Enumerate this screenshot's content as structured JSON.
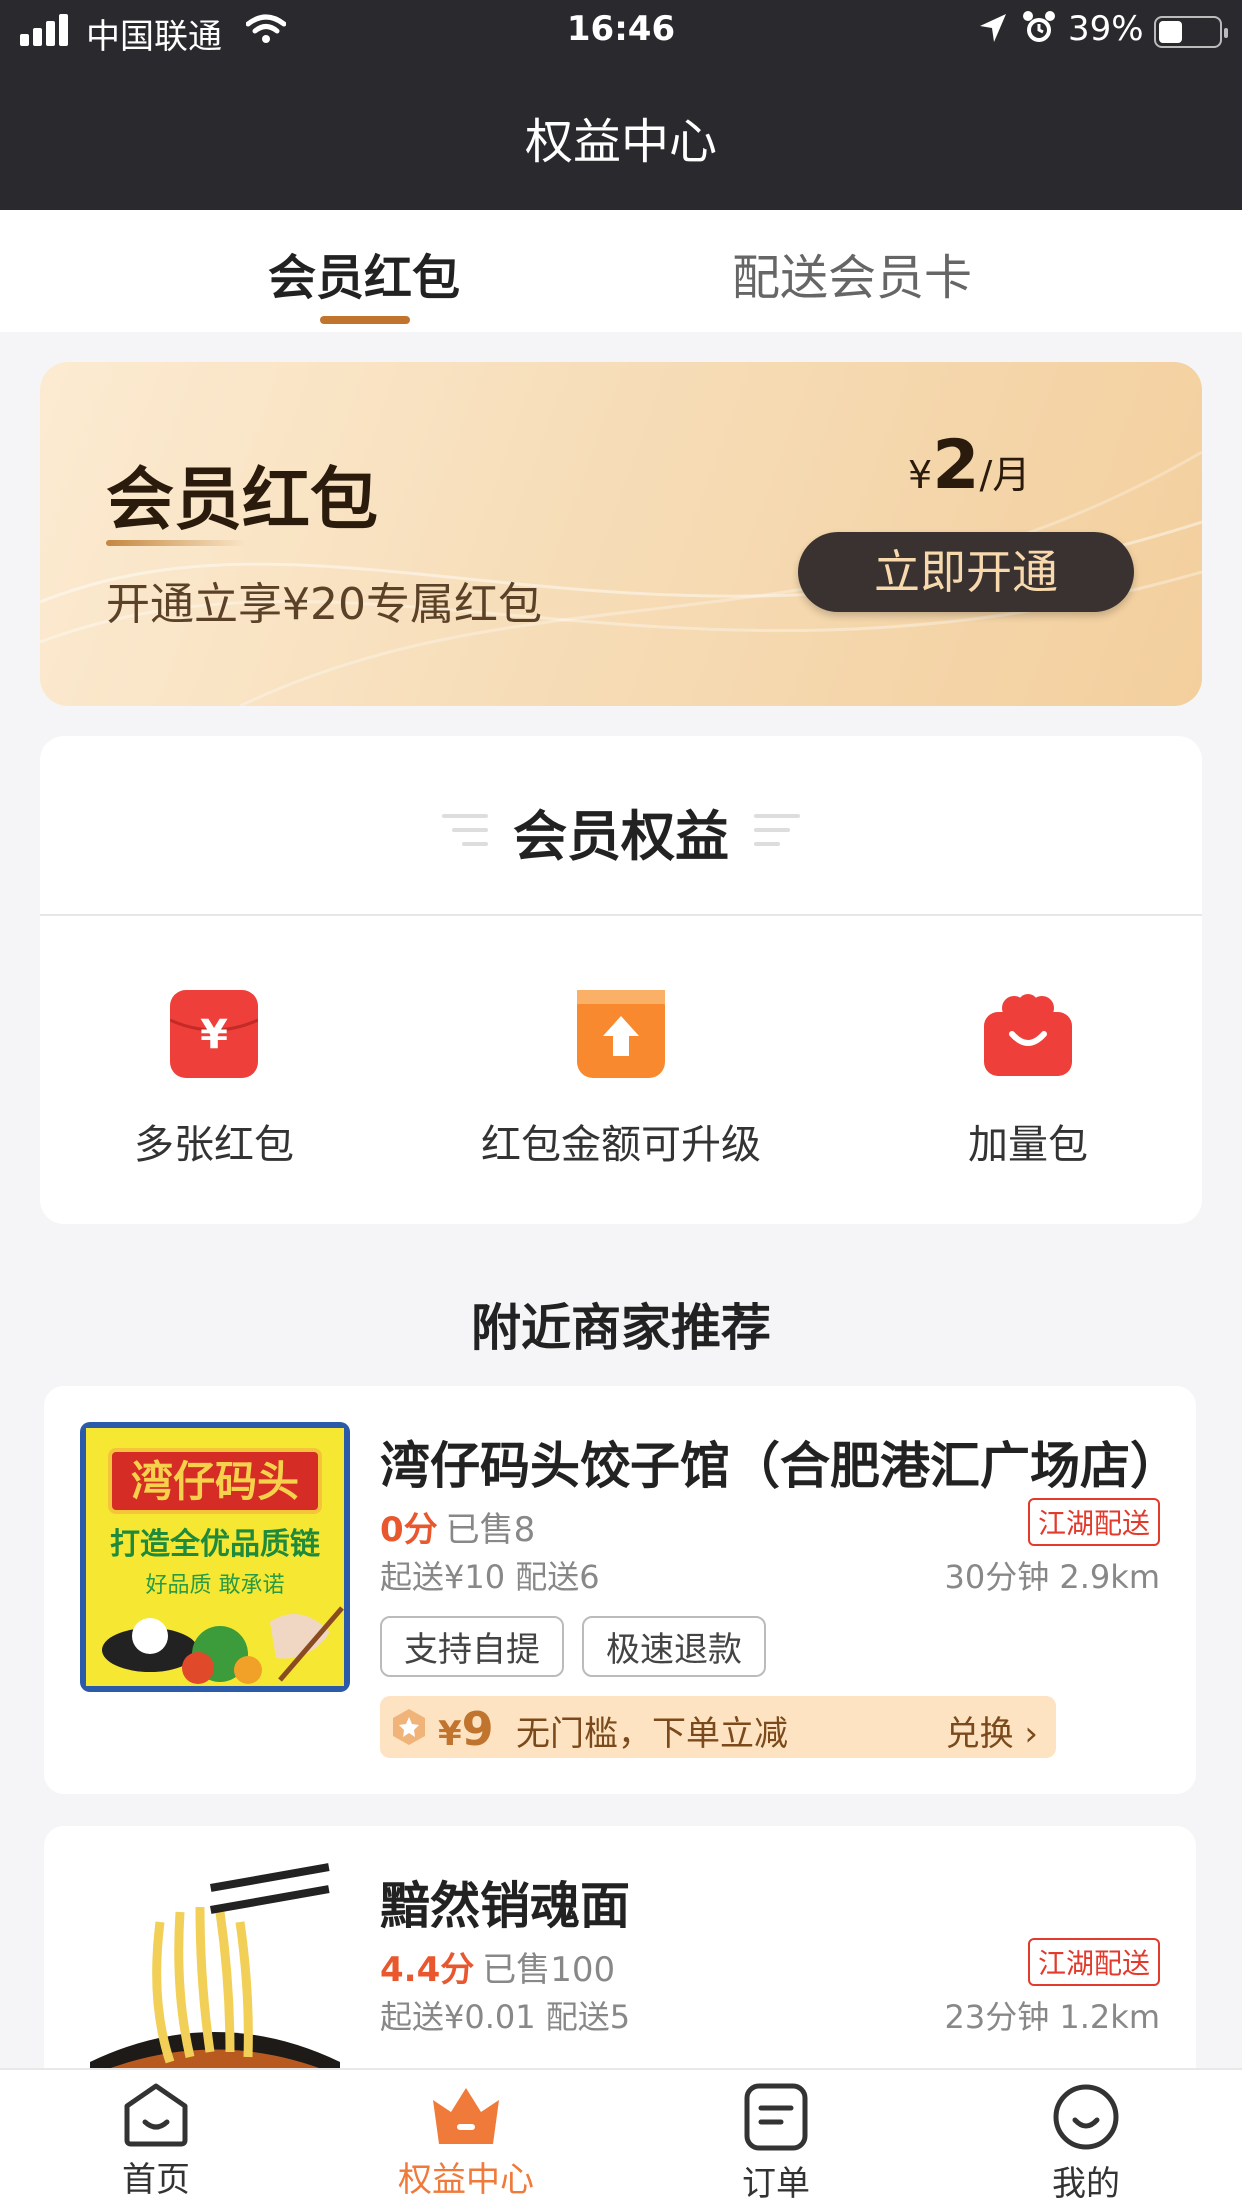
{
  "status": {
    "carrier": "中国联通",
    "time": "16:46",
    "battery": "39%"
  },
  "nav": {
    "title": "权益中心"
  },
  "tabs": [
    {
      "label": "会员红包",
      "active": true
    },
    {
      "label": "配送会员卡",
      "active": false
    }
  ],
  "promo": {
    "title": "会员红包",
    "subtitle": "开通立享¥20专属红包",
    "currency": "¥",
    "price": "2",
    "unit": "/月",
    "button": "立即开通"
  },
  "benefits": {
    "title": "会员权益",
    "items": [
      {
        "label": "多张红包",
        "icon": "red-envelope-icon"
      },
      {
        "label": "红包金额可升级",
        "icon": "upgrade-icon"
      },
      {
        "label": "加量包",
        "icon": "gift-bag-icon"
      }
    ]
  },
  "section": {
    "title": "附近商家推荐"
  },
  "shops": [
    {
      "name": "湾仔码头饺子馆（合肥港汇广场店）",
      "score": "0分",
      "sold": "已售8",
      "delivery_tag": "江湖配送",
      "min": "起送¥10 配送6",
      "dist": "30分钟 2.9km",
      "chips": [
        "支持自提",
        "极速退款"
      ],
      "coupon": {
        "currency": "¥",
        "amount": "9",
        "text": "无门槛，下单立减",
        "action": "兑换"
      },
      "logo_text_1": "湾仔码头",
      "logo_text_2": "打造全优品质链",
      "logo_text_3": "好品质 敢承诺"
    },
    {
      "name": "黯然销魂面",
      "score": "4.4分",
      "sold": "已售100",
      "delivery_tag": "江湖配送",
      "min": "起送¥0.01 配送5",
      "dist": "23分钟 1.2km"
    }
  ],
  "bottom_nav": [
    {
      "label": "首页",
      "icon": "home-icon",
      "active": false
    },
    {
      "label": "权益中心",
      "icon": "crown-icon",
      "active": true
    },
    {
      "label": "订单",
      "icon": "order-icon",
      "active": false
    },
    {
      "label": "我的",
      "icon": "profile-icon",
      "active": false
    }
  ],
  "colors": {
    "nav_bg": "#2a2a2e",
    "accent": "#c0742e",
    "active_tab": "#f07a3a",
    "red": "#e23a2c"
  }
}
